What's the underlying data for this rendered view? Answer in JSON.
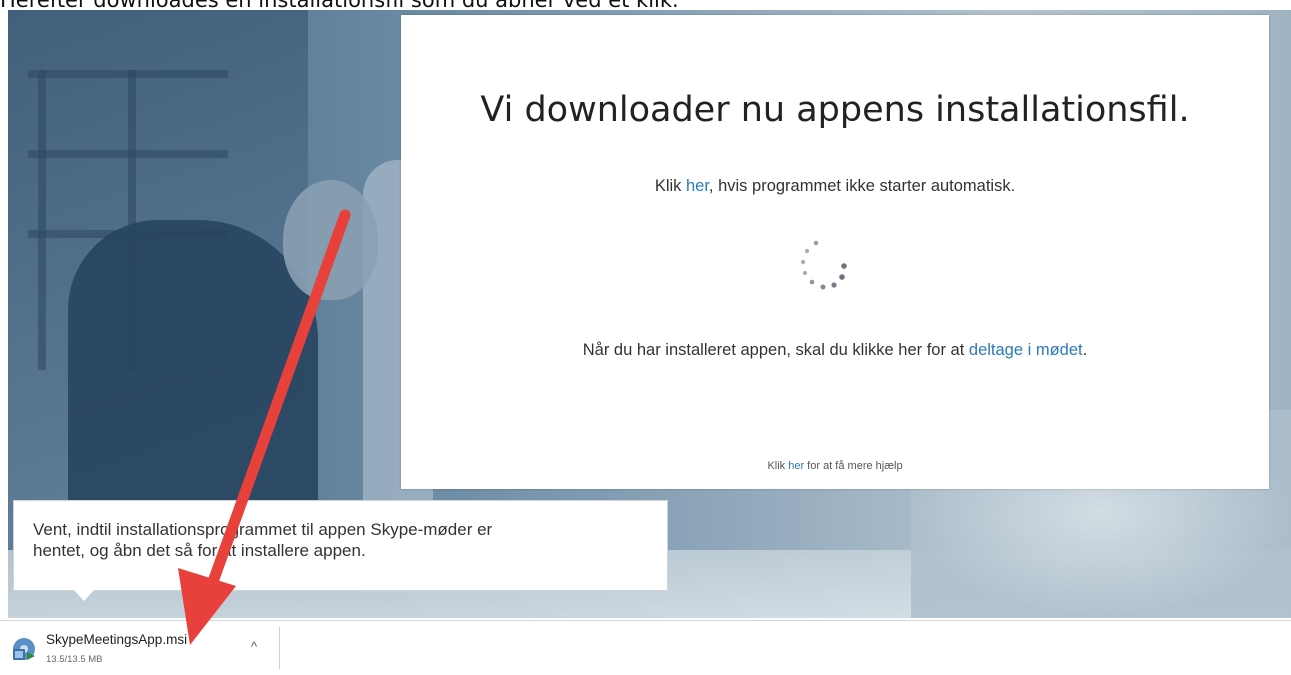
{
  "caption": "Herefter downloades en installationsfil som du åbner ved et klik.",
  "dialog": {
    "title": "Vi downloader nu appens installationsfil.",
    "line1_before": "Klik ",
    "line1_link": "her",
    "line1_after": ", hvis programmet ikke starter automatisk.",
    "line2_before": "Når du har installeret appen, skal du klikke her for at ",
    "line2_link": "deltage i mødet",
    "line2_after": ".",
    "help_before": "Klik ",
    "help_link": "her",
    "help_after": " for at få mere hjælp"
  },
  "tooltip": {
    "line1": "Vent, indtil installationsprogrammet til appen Skype-møder er",
    "line2": "hentet, og åbn det så for at installere appen."
  },
  "download": {
    "file_name": "SkypeMeetingsApp.msi",
    "progress_text": "13.5/13.5 MB",
    "chevron_icon": "chevron-up-icon",
    "file_icon": "msi-installer-icon"
  },
  "colors": {
    "link": "#2b7bb9",
    "arrow": "#e8403a",
    "dialog_bg": "#ffffff"
  }
}
